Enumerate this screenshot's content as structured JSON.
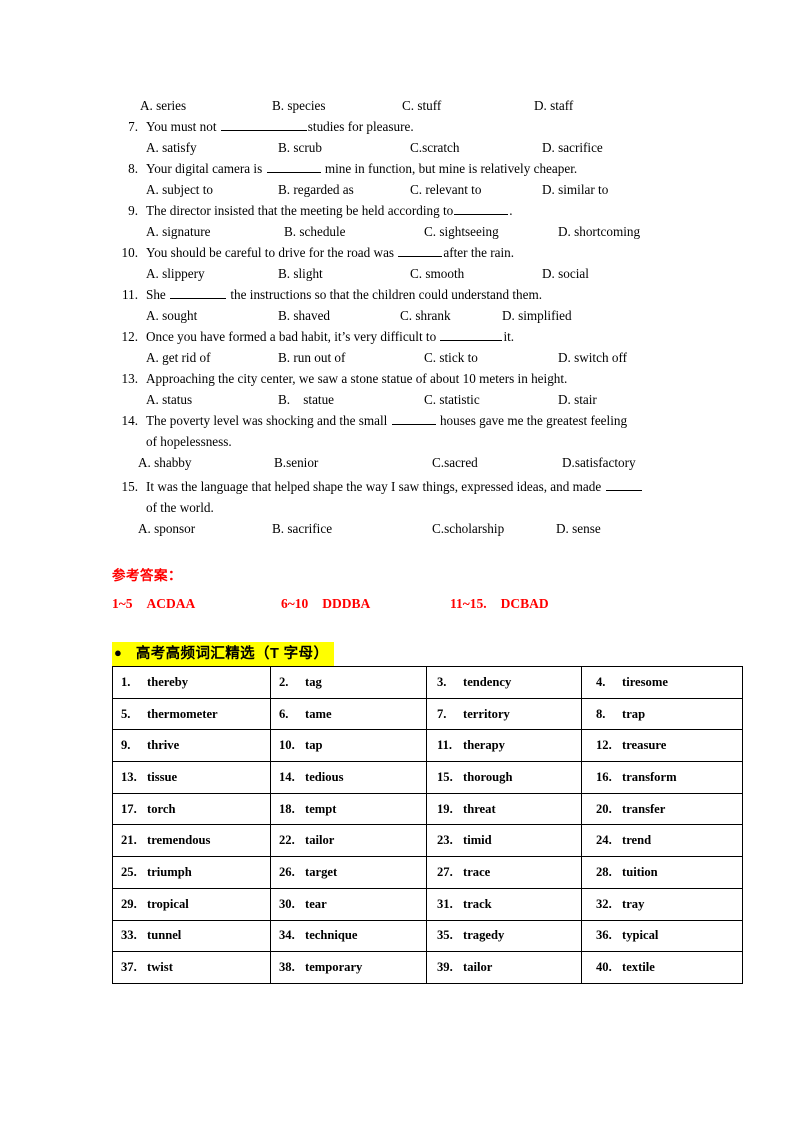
{
  "questions": [
    {
      "number": "",
      "stem_parts": [],
      "options": [
        "A. series",
        "B. species",
        "C. stuff",
        "D. staff"
      ],
      "opt_style": "wide"
    },
    {
      "number": "7.",
      "stem_before": "You must not ",
      "blank_width": 86,
      "stem_after": "studies for pleasure.",
      "options": [
        "A. satisfy",
        "B. scrub",
        "C.scratch",
        "D. sacrifice"
      ],
      "opt_style": "normal"
    },
    {
      "number": "8.",
      "stem_before": "Your digital camera is ",
      "blank_width": 54,
      "stem_after": " mine in function, but mine is relatively cheaper.",
      "options": [
        "A. subject to",
        "B. regarded as",
        "C. relevant to",
        "D. similar to"
      ],
      "opt_style": "normal"
    },
    {
      "number": "9.",
      "stem_before": "The director insisted that the meeting be held according to",
      "blank_width": 54,
      "stem_after": ".",
      "options": [
        "A. signature",
        "B. schedule",
        "C. sightseeing",
        "D. shortcoming"
      ],
      "opt_style": "wide"
    },
    {
      "number": "10.",
      "stem_before": "You should be careful to drive for the road was ",
      "blank_width": 44,
      "stem_after": "after the rain.",
      "options": [
        "A. slippery",
        "B. slight",
        "C. smooth",
        "D. social"
      ],
      "opt_style": "normal"
    },
    {
      "number": "11.",
      "stem_before": "She ",
      "blank_width": 56,
      "stem_after": " the instructions so that the children could understand them.",
      "options": [
        "A. sought",
        "B. shaved",
        "C. shrank",
        "D. simplified"
      ],
      "opt_style": "tight"
    },
    {
      "number": "12.",
      "stem_before": "Once you have formed a bad habit, it’s very difficult to ",
      "blank_width": 62,
      "stem_after": "it.",
      "options": [
        "A. get rid of",
        "B. run out of",
        "C. stick to",
        "D. switch off"
      ],
      "opt_style": "normal"
    },
    {
      "number": "13.",
      "stem_before": "Approaching the city center, we saw a stone statue of about 10 meters in height.",
      "blank_width": 0,
      "stem_after": "",
      "options": [
        "A. status",
        "B.    statue",
        "C. statistic",
        "D. stair"
      ],
      "opt_style": "normal"
    },
    {
      "number": "14.",
      "stem_before": "The poverty level was shocking and the small ",
      "blank_width": 44,
      "stem_after": " houses gave me the greatest feeling",
      "second_line": "of hopelessness.",
      "options": [
        "A. shabby",
        "B.senior",
        "C.sacred",
        "D.satisfactory"
      ],
      "opt_style": "indent"
    },
    {
      "number": "15.",
      "stem_before": "It was the language that helped shape the way I saw things, expressed ideas, and made ",
      "blank_width": 36,
      "stem_after": "",
      "second_line": "of the world.",
      "options": [
        "A. sponsor",
        "B. sacrifice",
        "C.scholarship",
        "D. sense"
      ],
      "opt_style": "indent"
    }
  ],
  "answer_key": {
    "heading": "参考答案：",
    "rows": [
      {
        "label": "1~5",
        "value": "ACDAA"
      },
      {
        "label": "6~10",
        "value": "DDDBA"
      },
      {
        "label": "11~15.",
        "value": "DCBAD"
      }
    ],
    "color": "#ff0000"
  },
  "section": {
    "bullet": "●",
    "title": "高考高频词汇精选（T 字母）",
    "highlight_color": "#ffff00"
  },
  "vocabulary": {
    "rows": [
      [
        {
          "n": "1.",
          "w": "thereby"
        },
        {
          "n": "2.",
          "w": "tag"
        },
        {
          "n": "3.",
          "w": "tendency"
        },
        {
          "n": "4.",
          "w": "tiresome"
        }
      ],
      [
        {
          "n": "5.",
          "w": "thermometer"
        },
        {
          "n": "6.",
          "w": "tame"
        },
        {
          "n": "7.",
          "w": "territory"
        },
        {
          "n": "8.",
          "w": "trap"
        }
      ],
      [
        {
          "n": "9.",
          "w": "thrive"
        },
        {
          "n": "10.",
          "w": "tap"
        },
        {
          "n": "11.",
          "w": "therapy"
        },
        {
          "n": "12.",
          "w": "treasure"
        }
      ],
      [
        {
          "n": "13.",
          "w": "tissue"
        },
        {
          "n": "14.",
          "w": "tedious"
        },
        {
          "n": "15.",
          "w": "thorough"
        },
        {
          "n": "16.",
          "w": "transform"
        }
      ],
      [
        {
          "n": "17.",
          "w": "torch"
        },
        {
          "n": "18.",
          "w": "tempt"
        },
        {
          "n": "19.",
          "w": "threat"
        },
        {
          "n": "20.",
          "w": "transfer"
        }
      ],
      [
        {
          "n": "21.",
          "w": "tremendous"
        },
        {
          "n": "22.",
          "w": "tailor"
        },
        {
          "n": "23.",
          "w": "timid"
        },
        {
          "n": "24.",
          "w": "trend"
        }
      ],
      [
        {
          "n": "25.",
          "w": "triumph"
        },
        {
          "n": "26.",
          "w": "target"
        },
        {
          "n": "27.",
          "w": "trace"
        },
        {
          "n": "28.",
          "w": "tuition"
        }
      ],
      [
        {
          "n": "29.",
          "w": "tropical"
        },
        {
          "n": "30.",
          "w": "tear"
        },
        {
          "n": "31.",
          "w": "track"
        },
        {
          "n": "32.",
          "w": "tray"
        }
      ],
      [
        {
          "n": "33.",
          "w": "tunnel"
        },
        {
          "n": "34.",
          "w": "technique"
        },
        {
          "n": "35.",
          "w": "tragedy"
        },
        {
          "n": "36.",
          "w": "typical"
        }
      ],
      [
        {
          "n": "37.",
          "w": "twist"
        },
        {
          "n": "38.",
          "w": "temporary"
        },
        {
          "n": "39.",
          "w": "tailor"
        },
        {
          "n": "40.",
          "w": "textile"
        }
      ]
    ]
  }
}
